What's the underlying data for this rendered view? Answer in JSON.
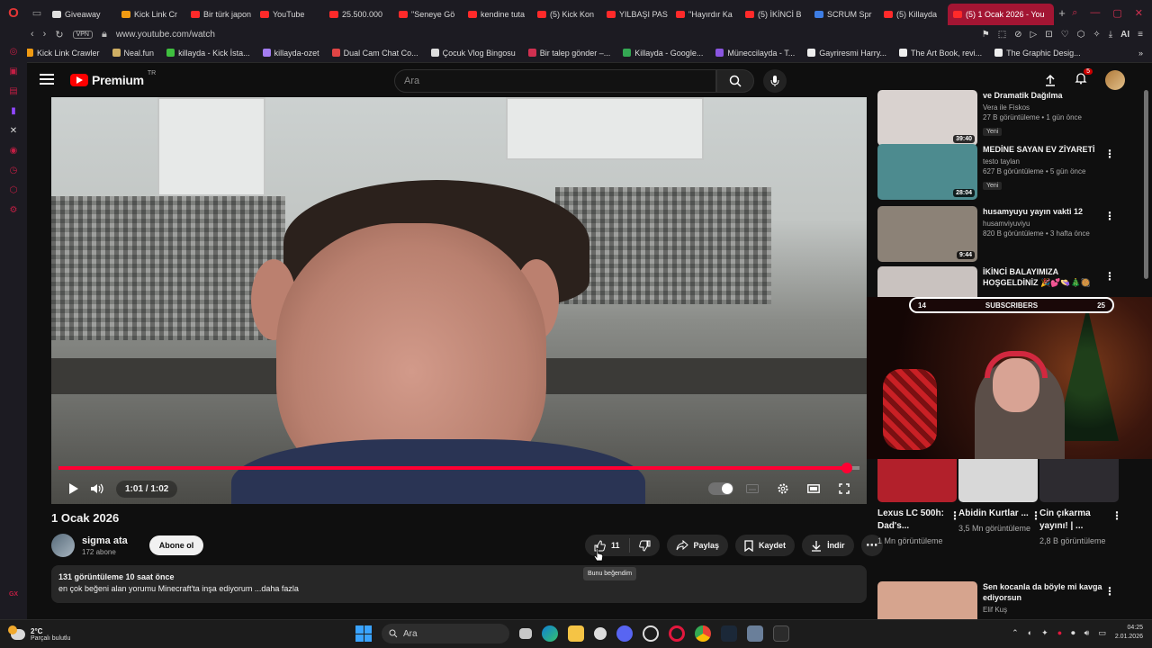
{
  "browser": {
    "tabs": [
      {
        "label": "Giveaway",
        "color": "#e0e0e0"
      },
      {
        "label": "Kick Link Cr",
        "color": "#f09a12"
      },
      {
        "label": "Bir türk japon",
        "color": "#ff2a2a"
      },
      {
        "label": "YouTube",
        "color": "#ff2a2a"
      },
      {
        "label": "25.500.000",
        "color": "#ff2a2a"
      },
      {
        "label": "\"Seneye Gö",
        "color": "#ff2a2a"
      },
      {
        "label": "kendine tuta",
        "color": "#ff2a2a"
      },
      {
        "label": "(5) Kick Kon",
        "color": "#ff2a2a"
      },
      {
        "label": "YILBAŞI PAS",
        "color": "#ff2a2a"
      },
      {
        "label": "\"Hayırdır Ka",
        "color": "#ff2a2a"
      },
      {
        "label": "(5) İKİNCİ B",
        "color": "#ff2a2a"
      },
      {
        "label": "SCRUM Spr",
        "color": "#3d7de4"
      },
      {
        "label": "(5) Killayda",
        "color": "#ff2a2a"
      },
      {
        "label": "(5) 1 Ocak 2026 - You",
        "color": "#ff2a2a"
      }
    ],
    "vpn": "VPN",
    "url": "www.youtube.com/watch",
    "ai": "AI",
    "bookmarks": [
      {
        "label": "Kick Link Crawler",
        "color": "#f09a12"
      },
      {
        "label": "Neal.fun",
        "color": "#cfae63"
      },
      {
        "label": "killayda - Kick İsta...",
        "color": "#3fbf3f"
      },
      {
        "label": "killayda-ozet",
        "color": "#a37cf0"
      },
      {
        "label": "Dual Cam Chat Co...",
        "color": "#e04545"
      },
      {
        "label": "Çocuk Vlog Bingosu",
        "color": "#dddddd"
      },
      {
        "label": "Bir talep gönder –...",
        "color": "#d03050"
      },
      {
        "label": "Killayda - Google...",
        "color": "#34a853"
      },
      {
        "label": "Müneccilayda - T...",
        "color": "#8a55e0"
      },
      {
        "label": "Gayriresmi Harry...",
        "color": "#eeeeee"
      },
      {
        "label": "The Art Book, revi...",
        "color": "#eeeeee"
      },
      {
        "label": "The Graphic Desig...",
        "color": "#eeeeee"
      }
    ]
  },
  "yt": {
    "logo": "Premium",
    "region": "TR",
    "search_placeholder": "Ara",
    "notif_count": "5"
  },
  "player": {
    "time": "1:01 / 1:02",
    "progress": 0.984
  },
  "video": {
    "title": "1 Ocak 2026",
    "channel": "sigma ata",
    "subs": "172 abone",
    "subscribe": "Abone ol",
    "likes": "11",
    "share": "Paylaş",
    "save": "Kaydet",
    "download": "İndir",
    "tooltip": "Bunu beğendim",
    "desc_meta": "131 görüntüleme  10 saat önce",
    "desc_text": "en çok beğeni alan yorumu Minecraft'ta inşa ediyorum ...daha fazla"
  },
  "sidebar_videos": [
    {
      "title": "ve Dramatik Dağılma",
      "channel": "Vera ile Fiskos",
      "meta": "27 B görüntüleme • 1 gün önce",
      "badge": "Yeni",
      "duration": "39:40",
      "thumb": "#d9d2cf"
    },
    {
      "title": "MEDİNE SAYAN EV ZİYARETİ",
      "channel": "testo taylan",
      "meta": "627 B görüntüleme • 5 gün önce",
      "badge": "Yeni",
      "duration": "28:04",
      "thumb": "#4d8b8f"
    },
    {
      "title": "husamyuyu yayın vakti 12",
      "channel": "husamviyuviyu",
      "meta": "820 B görüntüleme • 3 hafta önce",
      "badge": "",
      "duration": "9:44",
      "thumb": "#8c8277"
    },
    {
      "title": "İKİNCİ BALAYIMIZA HOŞGELDİNİZ 🎉💕👒🎄🥘",
      "channel": "",
      "meta": "",
      "badge": "",
      "duration": "",
      "thumb": "#c9c2bf"
    }
  ],
  "stream_overlay": {
    "left": "14",
    "label": "SUBSCRIBERS",
    "right": "25"
  },
  "shorts": [
    {
      "title": "Lexus LC 500h: Dad's...",
      "views": "1 Mn görüntüleme",
      "thumb": "#b2202b"
    },
    {
      "title": "Abidin Kurtlar ...",
      "views": "3,5 Mn görüntüleme",
      "thumb": "#d8d8d8"
    },
    {
      "title": "Cin çıkarma yayını! | ...",
      "views": "2,8 B görüntüleme",
      "thumb": "#2d2b30"
    }
  ],
  "bottom_video": {
    "title": "Sen kocanla da böyle mi kavga ediyorsun",
    "channel": "Elif Kuş",
    "thumb": "#d6a48e"
  },
  "taskbar": {
    "temp": "2°C",
    "weather": "Parçalı bulutlu",
    "search": "Ara",
    "time": "04:25",
    "date": "2.01.2026"
  }
}
